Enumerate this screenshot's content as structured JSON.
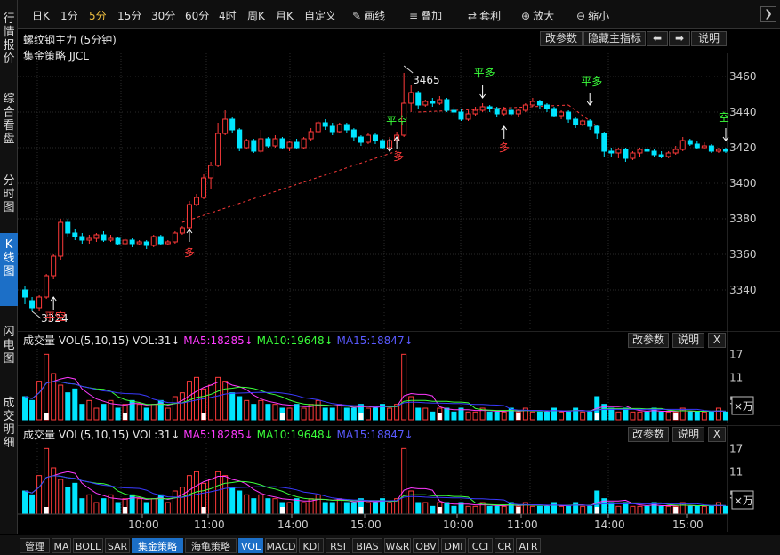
{
  "left_tabs": [
    {
      "label": "行情报价",
      "active": false
    },
    {
      "label": "综合看盘",
      "active": false
    },
    {
      "label": "分时图",
      "active": false
    },
    {
      "label": "K线图",
      "active": true
    },
    {
      "label": "闪电图",
      "active": false
    },
    {
      "label": "成交明细",
      "active": false
    }
  ],
  "toolbar": {
    "periods": [
      "日K",
      "1分",
      "5分",
      "15分",
      "30分",
      "60分",
      "4时",
      "周K",
      "月K",
      "自定义"
    ],
    "active_period": "5分",
    "draw": "画线",
    "overlay": "叠加",
    "arbitrage": "套利",
    "zoom_in": "放大",
    "zoom_out": "缩小"
  },
  "main_chart": {
    "title": "螺纹钢主力 (5分钟)",
    "strategy": "集金策略 JJCL",
    "buttons": {
      "edit_params": "改参数",
      "hide_indicator": "隐藏主指标",
      "help": "说明"
    },
    "high_label": "3465",
    "low_label": "3324",
    "signals": {
      "ping_kong": "平空",
      "duo": "多",
      "ping_duo": "平多",
      "kong": "空"
    }
  },
  "volume_panel": {
    "label": "成交量",
    "params": "VOL(5,10,15)",
    "vol": "VOL:31↓",
    "ma5": "MA5:18285↓",
    "ma10": "MA10:19648↓",
    "ma15": "MA15:18847↓",
    "edit_params": "改参数",
    "help": "说明",
    "close": "X",
    "unit": "×万",
    "yticks": [
      "17",
      "11",
      "5"
    ]
  },
  "colors": {
    "up": "#ff3a3a",
    "down": "#00e5ff",
    "ma5": "#ff3aff",
    "ma10": "#3aff3a",
    "ma15": "#3a3aff",
    "signal_green": "#3aff3a",
    "signal_red": "#ff3a3a"
  },
  "bottom_tabs": [
    "管理",
    "MA",
    "BOLL",
    "SAR",
    "集金策略",
    "海龟策略",
    "VOL",
    "MACD",
    "KDJ",
    "RSI",
    "BIAS",
    "W&R",
    "OBV",
    "DMI",
    "CCI",
    "CR",
    "ATR"
  ],
  "active_bottom_tabs": [
    "集金策略",
    "VOL"
  ],
  "chart_data": {
    "type": "candlestick",
    "y_ticks": [
      3460,
      3440,
      3420,
      3400,
      3380,
      3360,
      3340
    ],
    "ylim": [
      3320,
      3470
    ],
    "x_ticks": [
      "10:00",
      "11:00",
      "14:00",
      "15:00",
      "10:00",
      "11:00",
      "14:00",
      "15:00"
    ],
    "candles": [
      [
        3340,
        3336,
        3342,
        3332
      ],
      [
        3334,
        3330,
        3336,
        3328
      ],
      [
        3330,
        3336,
        3337,
        3328
      ],
      [
        3336,
        3348,
        3349,
        3335
      ],
      [
        3348,
        3359,
        3360,
        3346
      ],
      [
        3359,
        3378,
        3380,
        3357
      ],
      [
        3378,
        3372,
        3380,
        3370
      ],
      [
        3372,
        3370,
        3374,
        3368
      ],
      [
        3370,
        3368,
        3372,
        3366
      ],
      [
        3368,
        3369,
        3371,
        3366
      ],
      [
        3369,
        3371,
        3372,
        3367
      ],
      [
        3371,
        3368,
        3373,
        3367
      ],
      [
        3368,
        3369,
        3371,
        3367
      ],
      [
        3369,
        3366,
        3370,
        3365
      ],
      [
        3366,
        3368,
        3369,
        3365
      ],
      [
        3368,
        3366,
        3369,
        3364
      ],
      [
        3366,
        3367,
        3368,
        3365
      ],
      [
        3367,
        3365,
        3368,
        3363
      ],
      [
        3365,
        3370,
        3371,
        3364
      ],
      [
        3370,
        3366,
        3371,
        3365
      ],
      [
        3366,
        3367,
        3368,
        3365
      ],
      [
        3367,
        3372,
        3373,
        3366
      ],
      [
        3372,
        3375,
        3376,
        3371
      ],
      [
        3375,
        3388,
        3390,
        3374
      ],
      [
        3388,
        3392,
        3394,
        3387
      ],
      [
        3392,
        3403,
        3405,
        3391
      ],
      [
        3403,
        3410,
        3412,
        3397
      ],
      [
        3410,
        3428,
        3434,
        3409
      ],
      [
        3428,
        3436,
        3441,
        3427
      ],
      [
        3436,
        3430,
        3437,
        3428
      ],
      [
        3430,
        3420,
        3431,
        3418
      ],
      [
        3420,
        3424,
        3425,
        3419
      ],
      [
        3424,
        3418,
        3425,
        3417
      ],
      [
        3418,
        3425,
        3430,
        3417
      ],
      [
        3425,
        3421,
        3426,
        3420
      ],
      [
        3421,
        3425,
        3427,
        3420
      ],
      [
        3425,
        3420,
        3426,
        3419
      ],
      [
        3420,
        3423,
        3424,
        3418
      ],
      [
        3423,
        3420,
        3425,
        3419
      ],
      [
        3420,
        3425,
        3426,
        3419
      ],
      [
        3425,
        3429,
        3431,
        3424
      ],
      [
        3429,
        3434,
        3435,
        3428
      ],
      [
        3434,
        3432,
        3436,
        3430
      ],
      [
        3432,
        3429,
        3434,
        3427
      ],
      [
        3429,
        3433,
        3434,
        3428
      ],
      [
        3433,
        3430,
        3434,
        3428
      ],
      [
        3430,
        3426,
        3431,
        3424
      ],
      [
        3426,
        3423,
        3427,
        3421
      ],
      [
        3423,
        3427,
        3428,
        3422
      ],
      [
        3427,
        3424,
        3428,
        3422
      ],
      [
        3424,
        3420,
        3425,
        3419
      ],
      [
        3420,
        3424,
        3426,
        3419
      ],
      [
        3424,
        3427,
        3429,
        3422
      ],
      [
        3427,
        3445,
        3462,
        3426
      ],
      [
        3445,
        3451,
        3455,
        3440
      ],
      [
        3451,
        3444,
        3452,
        3442
      ],
      [
        3444,
        3446,
        3447,
        3443
      ],
      [
        3446,
        3445,
        3448,
        3443
      ],
      [
        3445,
        3447,
        3449,
        3444
      ],
      [
        3447,
        3441,
        3448,
        3440
      ],
      [
        3441,
        3440,
        3443,
        3438
      ],
      [
        3440,
        3436,
        3442,
        3435
      ],
      [
        3436,
        3439,
        3441,
        3435
      ],
      [
        3439,
        3441,
        3443,
        3438
      ],
      [
        3441,
        3443,
        3445,
        3440
      ],
      [
        3443,
        3442,
        3444,
        3440
      ],
      [
        3442,
        3439,
        3443,
        3437
      ],
      [
        3439,
        3441,
        3443,
        3438
      ],
      [
        3441,
        3439,
        3443,
        3438
      ],
      [
        3439,
        3441,
        3442,
        3437
      ],
      [
        3441,
        3444,
        3445,
        3440
      ],
      [
        3444,
        3446,
        3448,
        3443
      ],
      [
        3446,
        3444,
        3447,
        3442
      ],
      [
        3444,
        3442,
        3445,
        3440
      ],
      [
        3442,
        3438,
        3443,
        3437
      ],
      [
        3438,
        3440,
        3441,
        3436
      ],
      [
        3440,
        3436,
        3441,
        3434
      ],
      [
        3436,
        3433,
        3437,
        3431
      ],
      [
        3433,
        3435,
        3436,
        3432
      ],
      [
        3435,
        3432,
        3436,
        3430
      ],
      [
        3432,
        3428,
        3433,
        3425
      ],
      [
        3428,
        3418,
        3429,
        3415
      ],
      [
        3418,
        3417,
        3420,
        3415
      ],
      [
        3417,
        3419,
        3420,
        3414
      ],
      [
        3419,
        3414,
        3420,
        3412
      ],
      [
        3414,
        3417,
        3418,
        3413
      ],
      [
        3417,
        3419,
        3420,
        3415
      ],
      [
        3419,
        3418,
        3420,
        3416
      ],
      [
        3418,
        3416,
        3419,
        3415
      ],
      [
        3416,
        3415,
        3418,
        3414
      ],
      [
        3415,
        3417,
        3418,
        3414
      ],
      [
        3417,
        3419,
        3421,
        3416
      ],
      [
        3419,
        3424,
        3426,
        3418
      ],
      [
        3424,
        3422,
        3425,
        3421
      ],
      [
        3422,
        3420,
        3424,
        3419
      ],
      [
        3420,
        3421,
        3423,
        3419
      ],
      [
        3421,
        3418,
        3422,
        3417
      ],
      [
        3418,
        3419,
        3420,
        3417
      ],
      [
        3419,
        3418,
        3420,
        3417
      ]
    ],
    "volumes": [
      6,
      5,
      10,
      17,
      12,
      9,
      7,
      8,
      4,
      5,
      3,
      4,
      5,
      3,
      4,
      5,
      4,
      3,
      4,
      5,
      3,
      6,
      7,
      10,
      11,
      8,
      9,
      11,
      10,
      7,
      6,
      5,
      4,
      5,
      4,
      4,
      3,
      3,
      4,
      3,
      4,
      5,
      3,
      3,
      4,
      3,
      3,
      4,
      3,
      3,
      4,
      3,
      4,
      17,
      6,
      3,
      3,
      2,
      3,
      3,
      2,
      3,
      2,
      2,
      3,
      2,
      2,
      2,
      3,
      2,
      3,
      2,
      2,
      2,
      3,
      2,
      2,
      3,
      2,
      2,
      6,
      4,
      3,
      2,
      3,
      2,
      2,
      2,
      3,
      2,
      2,
      2,
      3,
      2,
      2,
      2,
      2,
      3,
      2
    ]
  }
}
